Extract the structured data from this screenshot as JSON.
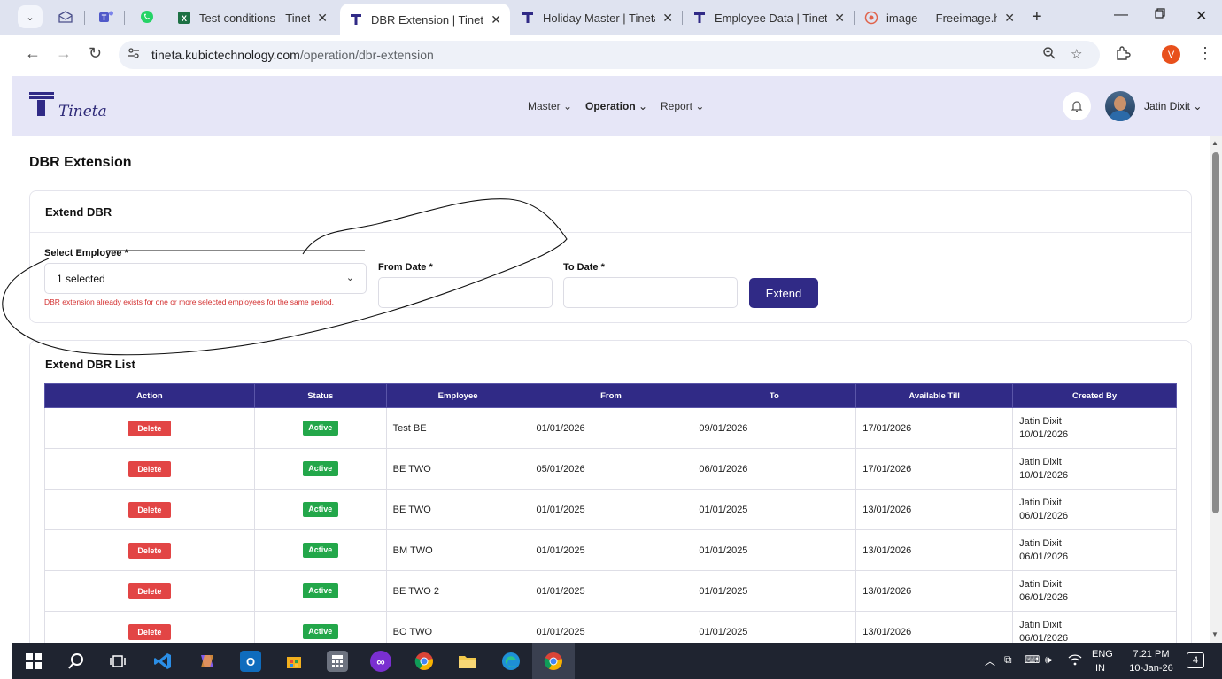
{
  "browser": {
    "tabs": [
      {
        "label": "Test conditions - Tineta",
        "favicon": "excel-icon",
        "active": false
      },
      {
        "label": "DBR Extension | Tineta",
        "favicon": "tineta-icon",
        "active": true
      },
      {
        "label": "Holiday Master | Tineta",
        "favicon": "tineta-icon",
        "active": false
      },
      {
        "label": "Employee Data | Tineta",
        "favicon": "tineta-icon",
        "active": false
      },
      {
        "label": "image — Freeimage.ho",
        "favicon": "freeimage-icon",
        "active": false
      }
    ],
    "url_host": "tineta.kubictechnology.com",
    "url_path": "/operation/dbr-extension",
    "profile_initial": "V"
  },
  "header": {
    "logo_text": "Tineta",
    "menu": [
      "Master",
      "Operation",
      "Report"
    ],
    "active_menu": "Operation",
    "user_name": "Jatin Dixit"
  },
  "page": {
    "title": "DBR Extension",
    "form": {
      "card_title": "Extend DBR",
      "employee_label": "Select Employee *",
      "employee_value": "1 selected",
      "error_text": "DBR extension already exists for one or more selected employees for the same period.",
      "from_label": "From Date *",
      "from_value": "",
      "to_label": "To Date *",
      "to_value": "",
      "extend_label": "Extend"
    },
    "list": {
      "title": "Extend DBR List",
      "columns": [
        "Action",
        "Status",
        "Employee",
        "From",
        "To",
        "Available Till",
        "Created By"
      ],
      "delete_label": "Delete",
      "rows": [
        {
          "status": "Active",
          "employee": "Test BE",
          "from": "01/01/2026",
          "to": "09/01/2026",
          "available_till": "17/01/2026",
          "created_by": "Jatin Dixit",
          "created_on": "10/01/2026"
        },
        {
          "status": "Active",
          "employee": "BE TWO",
          "from": "05/01/2026",
          "to": "06/01/2026",
          "available_till": "17/01/2026",
          "created_by": "Jatin Dixit",
          "created_on": "10/01/2026"
        },
        {
          "status": "Active",
          "employee": "BE TWO",
          "from": "01/01/2025",
          "to": "01/01/2025",
          "available_till": "13/01/2026",
          "created_by": "Jatin Dixit",
          "created_on": "06/01/2026"
        },
        {
          "status": "Active",
          "employee": "BM TWO",
          "from": "01/01/2025",
          "to": "01/01/2025",
          "available_till": "13/01/2026",
          "created_by": "Jatin Dixit",
          "created_on": "06/01/2026"
        },
        {
          "status": "Active",
          "employee": "BE TWO 2",
          "from": "01/01/2025",
          "to": "01/01/2025",
          "available_till": "13/01/2026",
          "created_by": "Jatin Dixit",
          "created_on": "06/01/2026"
        },
        {
          "status": "Active",
          "employee": "BO TWO",
          "from": "01/01/2025",
          "to": "01/01/2025",
          "available_till": "13/01/2026",
          "created_by": "Jatin Dixit",
          "created_on": "06/01/2026"
        }
      ]
    }
  },
  "taskbar": {
    "lang_line1": "ENG",
    "lang_line2": "IN",
    "time": "7:21 PM",
    "date": "10-Jan-26",
    "notifications": "4"
  },
  "colors": {
    "primary": "#302a86",
    "header_bg": "#e6e6f7",
    "danger": "#e24545",
    "success": "#23a74a",
    "error_text": "#d32f2f"
  }
}
